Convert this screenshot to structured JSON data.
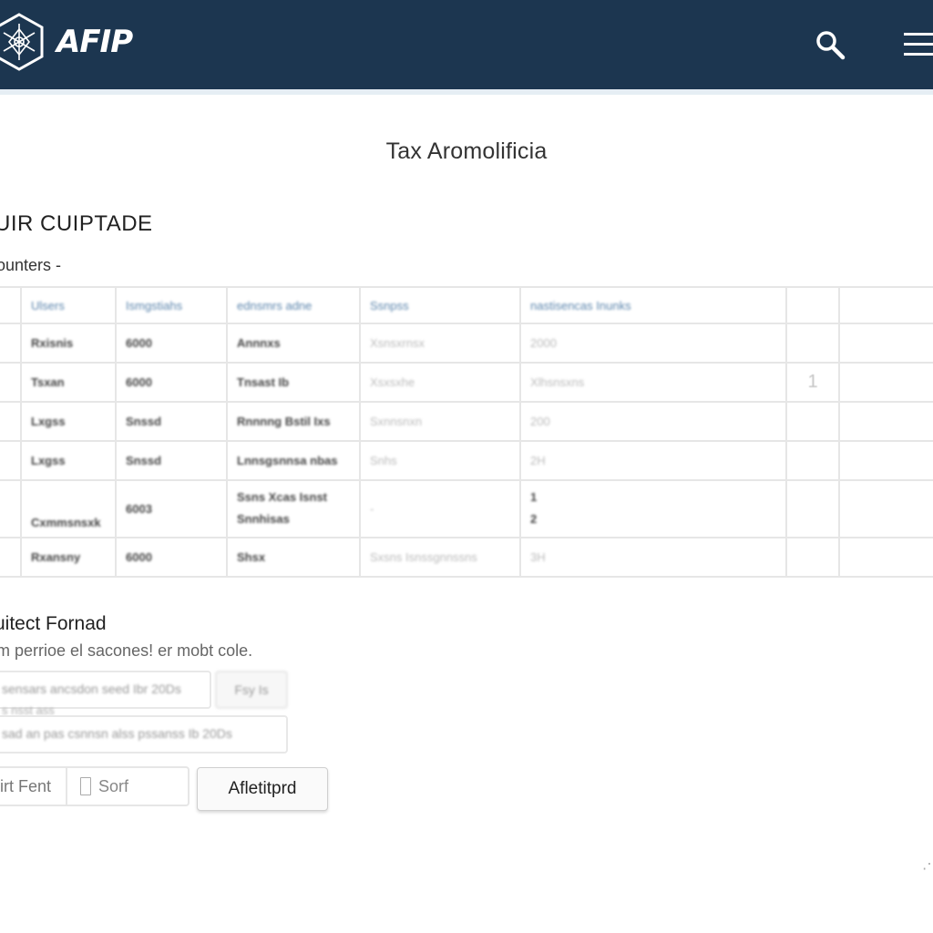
{
  "header": {
    "brand": "AFIP",
    "logo_icon": "hexagon-emblem-icon",
    "search_icon": "search-icon",
    "menu_icon": "hamburger-menu-icon"
  },
  "page": {
    "title": "Tax Aromolificia",
    "section_heading": "UIR CUIPTADE",
    "filter_label": "ounters -"
  },
  "table": {
    "headers": [
      "Ulsers",
      "Ismgstiahs",
      "ednsmrs adne",
      "Ssnpss",
      "nastisencas Inunks",
      "",
      ""
    ],
    "rows": [
      {
        "cells": [
          "Rxisnis",
          "6000",
          "Annnxs",
          "Xsnsxrnsx",
          "2000",
          "",
          ""
        ]
      },
      {
        "cells": [
          "Tsxan",
          "6000",
          "Tnsast Ib",
          "Xsxsxhe",
          "Xlhsnsxns",
          "1",
          ""
        ]
      },
      {
        "cells": [
          "Lxgss",
          "Snssd",
          "Rnnnng Bstil Ixs",
          "Sxnnsnxn",
          "200",
          "",
          ""
        ]
      },
      {
        "cells": [
          "Lxgss",
          "Snssd",
          "Lnnsgsnnsa nbas",
          "Snhs",
          "2H",
          "",
          ""
        ]
      },
      {
        "cells": [
          "Cxmmsnsxk",
          "6003",
          "Ssns Xcas Isnst|Snnhisas",
          "-",
          "1|2",
          "",
          ""
        ]
      },
      {
        "cells": [
          "Rxansny",
          "6000",
          "Shsx",
          "Sxsns Isnssgnnssns",
          "3H",
          "",
          ""
        ]
      }
    ]
  },
  "form": {
    "heading": "uitect Fornad",
    "description": "m perrioe el sacones! er mobt cole.",
    "field1_value": "sensars ancsdon seed Ibr 20Ds",
    "field1_button": "Fsy Is",
    "field_note": "s nsst ass",
    "field2_value": "sad an pas csnnsn alss pssanss Ib 20Ds",
    "field3_label": "irt Fent",
    "field3_value": "Sorf",
    "submit_label": "Afletitprd"
  }
}
